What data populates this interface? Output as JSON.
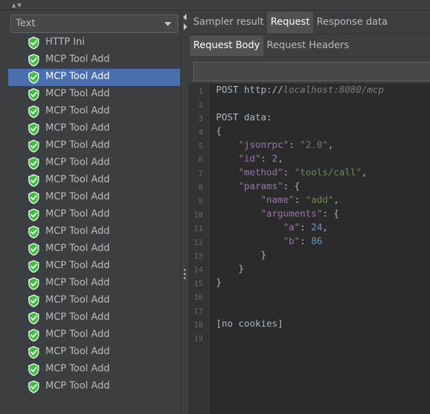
{
  "left_panel": {
    "view_select": {
      "selected": "Text"
    },
    "tree_items": [
      {
        "label": "HTTP Ini",
        "selected": false
      },
      {
        "label": "MCP Tool Add",
        "selected": false
      },
      {
        "label": "MCP Tool Add",
        "selected": true
      },
      {
        "label": "MCP Tool Add",
        "selected": false
      },
      {
        "label": "MCP Tool Add",
        "selected": false
      },
      {
        "label": "MCP Tool Add",
        "selected": false
      },
      {
        "label": "MCP Tool Add",
        "selected": false
      },
      {
        "label": "MCP Tool Add",
        "selected": false
      },
      {
        "label": "MCP Tool Add",
        "selected": false
      },
      {
        "label": "MCP Tool Add",
        "selected": false
      },
      {
        "label": "MCP Tool Add",
        "selected": false
      },
      {
        "label": "MCP Tool Add",
        "selected": false
      },
      {
        "label": "MCP Tool Add",
        "selected": false
      },
      {
        "label": "MCP Tool Add",
        "selected": false
      },
      {
        "label": "MCP Tool Add",
        "selected": false
      },
      {
        "label": "MCP Tool Add",
        "selected": false
      },
      {
        "label": "MCP Tool Add",
        "selected": false
      },
      {
        "label": "MCP Tool Add",
        "selected": false
      },
      {
        "label": "MCP Tool Add",
        "selected": false
      },
      {
        "label": "MCP Tool Add",
        "selected": false
      },
      {
        "label": "MCP Tool Add",
        "selected": false
      }
    ],
    "status_icon": "success-shield-icon",
    "status_color": "#3fbf3f"
  },
  "right_panel": {
    "tabs": [
      {
        "label": "Sampler result",
        "active": false
      },
      {
        "label": "Request",
        "active": true
      },
      {
        "label": "Response data",
        "active": false
      }
    ],
    "sub_tabs": [
      {
        "label": "Request Body",
        "active": true
      },
      {
        "label": "Request Headers",
        "active": false
      }
    ],
    "search_value": "",
    "editor": {
      "lines": [
        [
          {
            "t": "POST "
          },
          {
            "t": "http://",
            "c": "plain"
          },
          {
            "t": "localhost:8080/mcp",
            "c": "url"
          }
        ],
        [],
        [
          {
            "t": "POST data:"
          }
        ],
        [
          {
            "t": "{"
          }
        ],
        [
          {
            "t": "    "
          },
          {
            "t": "\"jsonrpc\"",
            "c": "key"
          },
          {
            "t": ": "
          },
          {
            "t": "\"2.0\"",
            "c": "str"
          },
          {
            "t": ","
          }
        ],
        [
          {
            "t": "    "
          },
          {
            "t": "\"id\"",
            "c": "key"
          },
          {
            "t": ": "
          },
          {
            "t": "2",
            "c": "num"
          },
          {
            "t": ","
          }
        ],
        [
          {
            "t": "    "
          },
          {
            "t": "\"method\"",
            "c": "key"
          },
          {
            "t": ": "
          },
          {
            "t": "\"tools/call\"",
            "c": "str"
          },
          {
            "t": ","
          }
        ],
        [
          {
            "t": "    "
          },
          {
            "t": "\"params\"",
            "c": "key"
          },
          {
            "t": ": {"
          }
        ],
        [
          {
            "t": "        "
          },
          {
            "t": "\"name\"",
            "c": "key"
          },
          {
            "t": ": "
          },
          {
            "t": "\"add\"",
            "c": "str"
          },
          {
            "t": ","
          }
        ],
        [
          {
            "t": "        "
          },
          {
            "t": "\"arguments\"",
            "c": "key"
          },
          {
            "t": ": {"
          }
        ],
        [
          {
            "t": "            "
          },
          {
            "t": "\"a\"",
            "c": "key"
          },
          {
            "t": ": "
          },
          {
            "t": "24",
            "c": "num"
          },
          {
            "t": ","
          }
        ],
        [
          {
            "t": "            "
          },
          {
            "t": "\"b\"",
            "c": "key"
          },
          {
            "t": ": "
          },
          {
            "t": "86",
            "c": "num"
          }
        ],
        [
          {
            "t": "        }"
          }
        ],
        [
          {
            "t": "    }"
          }
        ],
        [
          {
            "t": "}"
          }
        ],
        [],
        [],
        [
          {
            "t": "[no cookies]"
          }
        ],
        []
      ],
      "colors": {
        "background": "#2b2b2b",
        "key": "#9876aa",
        "string": "#6a8759",
        "number": "#6897bb",
        "plain": "#a9b7c6"
      }
    }
  }
}
